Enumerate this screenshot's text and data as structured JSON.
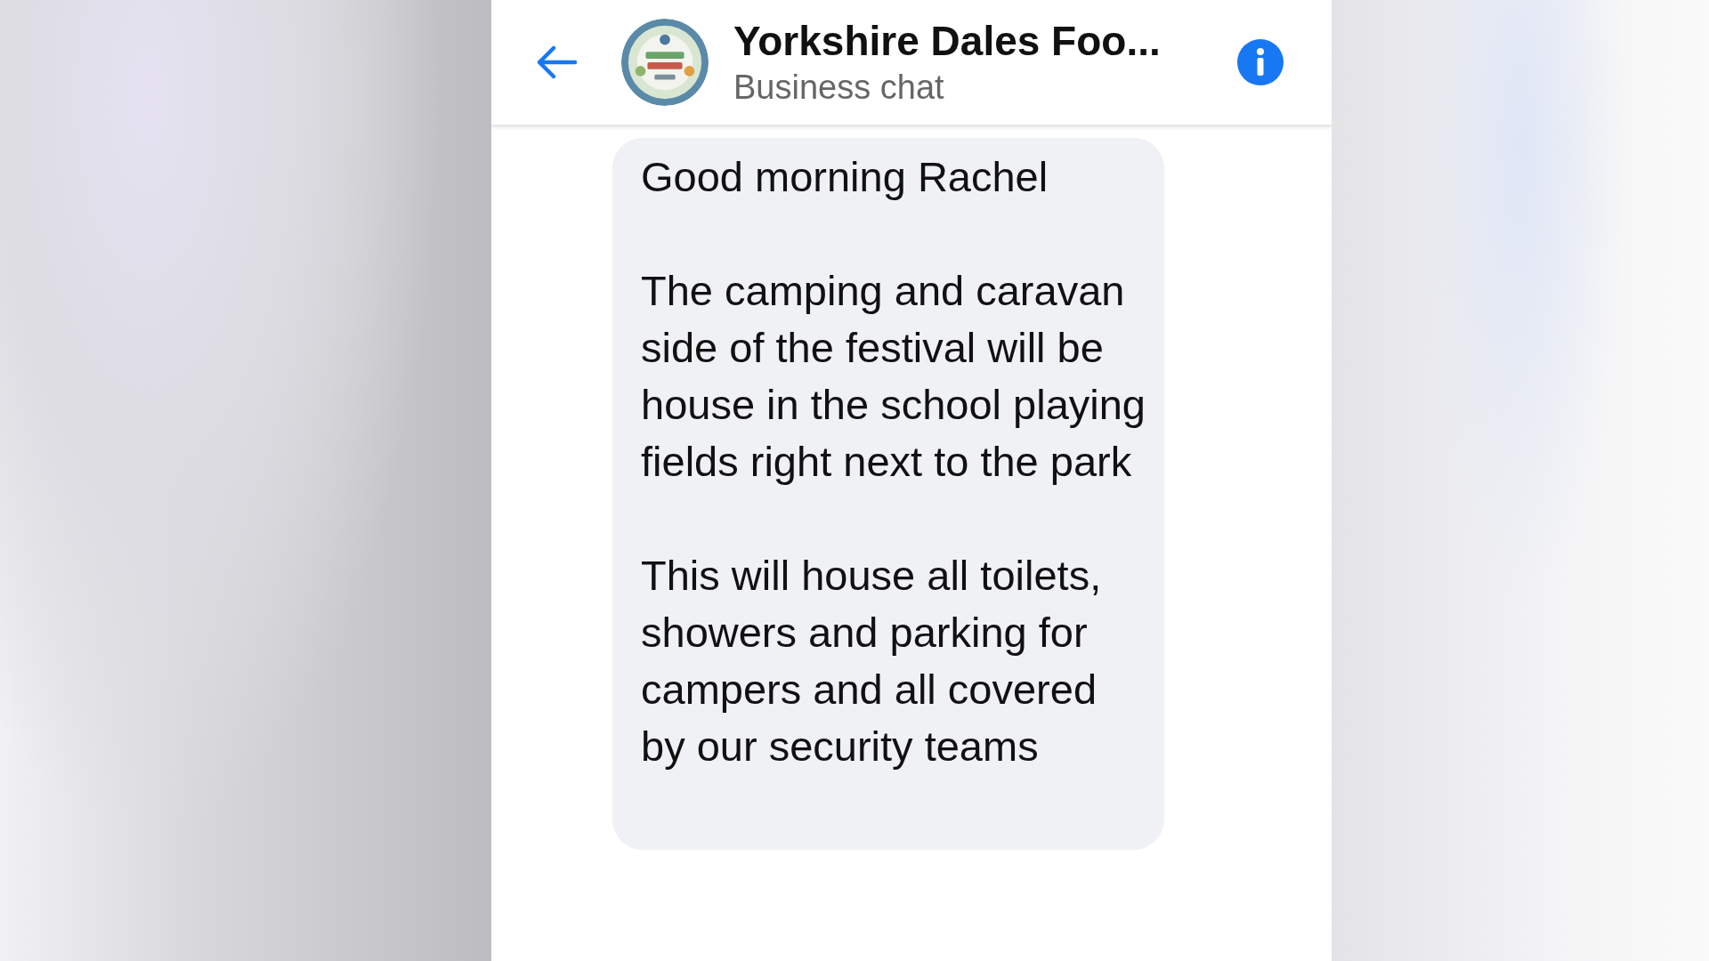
{
  "header": {
    "title": "Yorkshire Dales Foo...",
    "subtitle": "Business chat"
  },
  "messages": [
    {
      "paragraphs": [
        "Good morning Rachel",
        "The camping and caravan side of the festival will be house in the school playing fields right next to the park",
        "This will house all toilets, showers and parking for campers and all covered by our security teams"
      ]
    }
  ]
}
